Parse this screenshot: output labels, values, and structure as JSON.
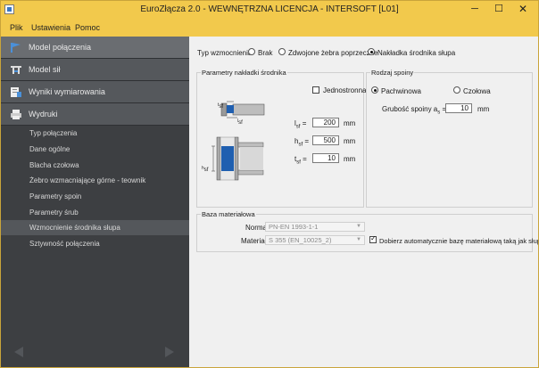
{
  "window": {
    "title": "EuroZłącza 2.0 - WEWNĘTRZNA LICENCJA - INTERSOFT [L01]",
    "min": "─",
    "max": "☐",
    "close": "✕"
  },
  "menu": [
    "Plik",
    "Ustawienia",
    "Pomoc"
  ],
  "sidebar": {
    "sections": [
      {
        "label": "Model połączenia",
        "icon": "flag-icon"
      },
      {
        "label": "Model sił",
        "icon": "forces-model-icon"
      },
      {
        "label": "Wyniki wymiarowania",
        "icon": "results-icon"
      },
      {
        "label": "Wydruki",
        "icon": "printer-icon"
      }
    ],
    "items": [
      "Typ połączenia",
      "Dane ogólne",
      "Blacha czołowa",
      "Żebro wzmacniające górne - teownik",
      "Parametry spoin",
      "Parametry śrub",
      "Wzmocnienie środnika słupa",
      "Sztywność połączenia"
    ],
    "selected_item": "Wzmocnienie środnika słupa"
  },
  "reinforcement": {
    "label": "Typ wzmocnienia",
    "options": [
      "Brak",
      "Zdwojone żebra poprzeczne",
      "Nakładka środnika słupa"
    ],
    "selected": "Nakładka środnika słupa"
  },
  "plate_params": {
    "title": "Parametry nakładki środnika",
    "one_sided_label": "Jednostronna",
    "one_sided": false,
    "diagram_labels": {
      "t": "t",
      "t_sub": "sf",
      "l": "l",
      "l_sub": "sf",
      "h": "h",
      "h_sub": "sf"
    },
    "fields": [
      {
        "symbol": "l",
        "sub": "sf",
        "eq": "=",
        "value": "200",
        "unit": "mm"
      },
      {
        "symbol": "h",
        "sub": "sf",
        "eq": "=",
        "value": "500",
        "unit": "mm"
      },
      {
        "symbol": "t",
        "sub": "sf",
        "eq": "=",
        "value": "10",
        "unit": "mm"
      }
    ]
  },
  "weld": {
    "title": "Rodzaj spoiny",
    "options": [
      "Pachwinowa",
      "Czołowa"
    ],
    "selected": "Pachwinowa",
    "thickness_label": "Grubość spoiny a",
    "thickness_sub": "s",
    "eq": "=",
    "thickness_value": "10",
    "unit": "mm"
  },
  "material": {
    "title": "Baza materiałowa",
    "norm_label": "Norma",
    "norm_value": "PN-EN 1993-1-1",
    "material_label": "Materiał",
    "material_value": "S 355 (EN_10025_2)",
    "auto_label": "Dobierz automatycznie bazę materiałową taką jak słup",
    "auto": true
  },
  "colors": {
    "titlebar": "#f2c94c",
    "sidebar": "#3d3f42",
    "plate": "#1f5fb0"
  }
}
